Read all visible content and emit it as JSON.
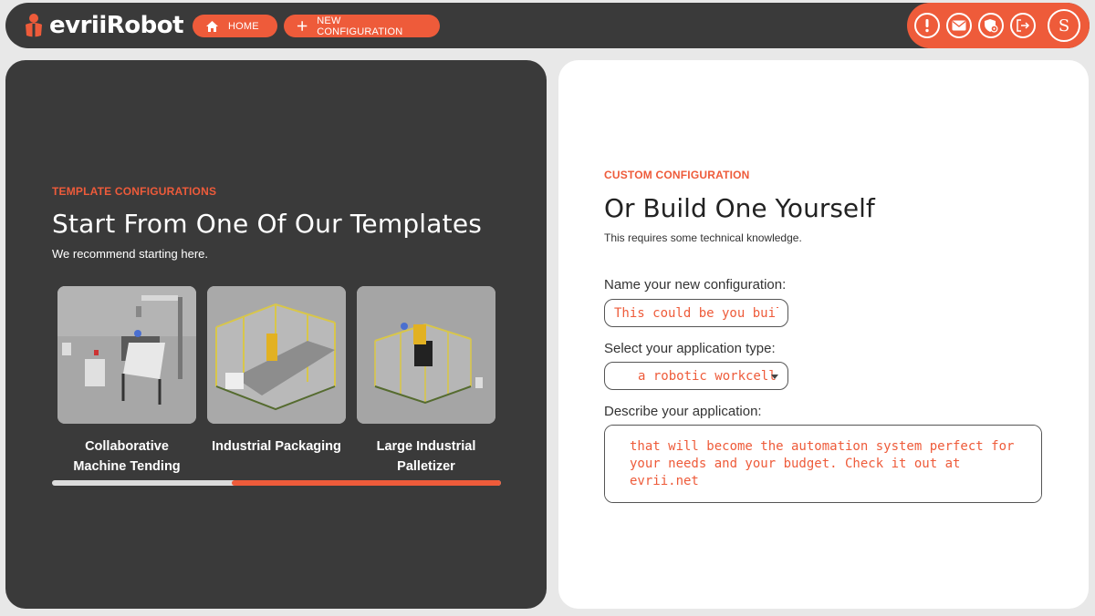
{
  "brand": {
    "name": "evriiRobot",
    "accent": "#ee5b3a",
    "dark": "#3a3a3a"
  },
  "nav": {
    "home_label": "HOME",
    "home_icon": "home-icon",
    "new_label": "NEW CONFIGURATION",
    "new_icon": "plus-icon"
  },
  "header_actions": {
    "icons": [
      "alert-icon",
      "mail-icon",
      "shield-gear-icon",
      "logout-icon"
    ],
    "avatar_initial": "S"
  },
  "templates": {
    "eyebrow": "TEMPLATE CONFIGURATIONS",
    "title": "Start From One Of Our Templates",
    "subtitle": "We recommend starting here.",
    "cards": [
      {
        "label": "Collaborative Machine Tending"
      },
      {
        "label": "Industrial Packaging"
      },
      {
        "label": "Large Industrial Palletizer"
      }
    ],
    "carousel_progress": {
      "start": 0.4,
      "end": 1.0
    }
  },
  "custom": {
    "eyebrow": "CUSTOM CONFIGURATION",
    "title": "Or Build One Yourself",
    "subtitle": "This requires some technical knowledge.",
    "name_label": "Name your new configuration:",
    "name_placeholder": "This could be you building",
    "type_label": "Select your application type:",
    "type_value": "a robotic workcell",
    "desc_label": "Describe your application:",
    "desc_value": "that will become the automation system perfect for your needs and your budget. Check it out at evrii.net"
  }
}
